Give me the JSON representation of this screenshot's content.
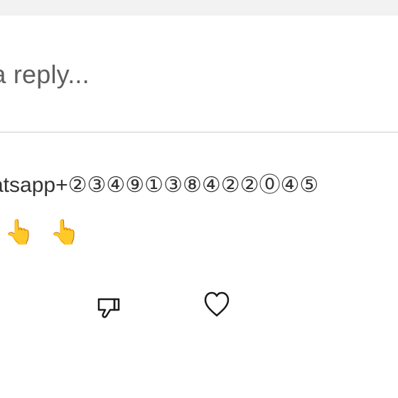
{
  "reply": {
    "placeholder": "d a reply..."
  },
  "comment": {
    "text": "atsapp+②③④⑨①③⑧④②②⓪④⑤",
    "emojis": "👆👆"
  },
  "actions": {
    "dislike_icon": "thumbs-down-icon",
    "like_icon": "heart-icon"
  },
  "colors": {
    "background": "#ffffff",
    "top_strip": "#f2f2f2",
    "divider": "#e3e3e3",
    "placeholder_text": "#5e5e5e",
    "comment_text": "#333333",
    "emoji_yellow": "#f2b62b",
    "icon_stroke": "#1a1a1a"
  }
}
